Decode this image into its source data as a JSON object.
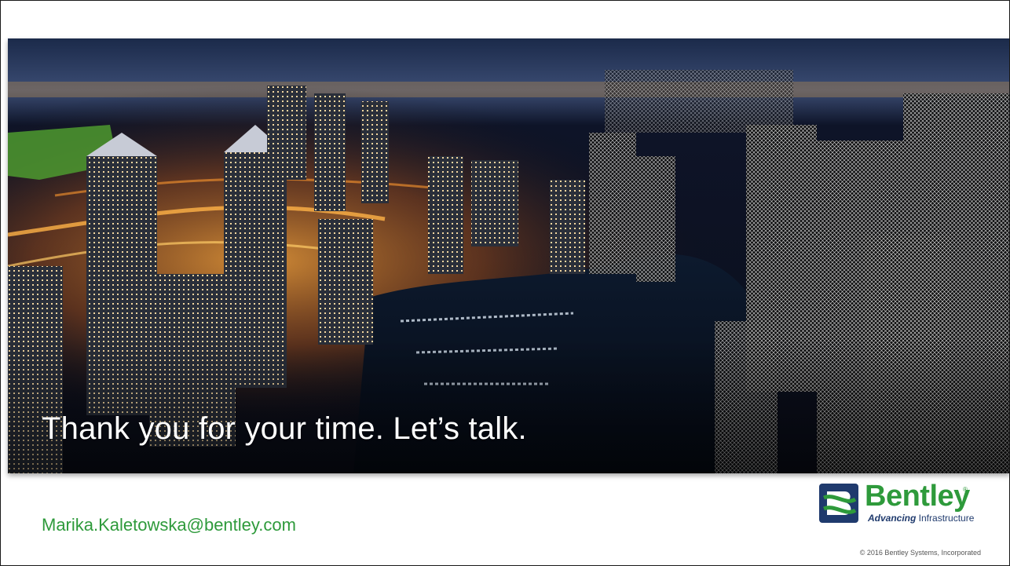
{
  "slide": {
    "headline": "Thank you for your time. Let’s talk.",
    "email": "Marika.Kaletowska@bentley.com",
    "copyright": "© 2016 Bentley Systems, Incorporated"
  },
  "logo": {
    "name": "Bentley",
    "tagline_bold": "Advancing",
    "tagline_rest": " Infrastructure",
    "icon": "bentley-b-icon"
  },
  "hero_image": {
    "icon": "city-skyline-photo",
    "description_tag": "city-marina-night"
  },
  "colors": {
    "brand_green": "#2e9a3b",
    "brand_navy": "#1f3a6d",
    "text_white": "#ffffff"
  }
}
